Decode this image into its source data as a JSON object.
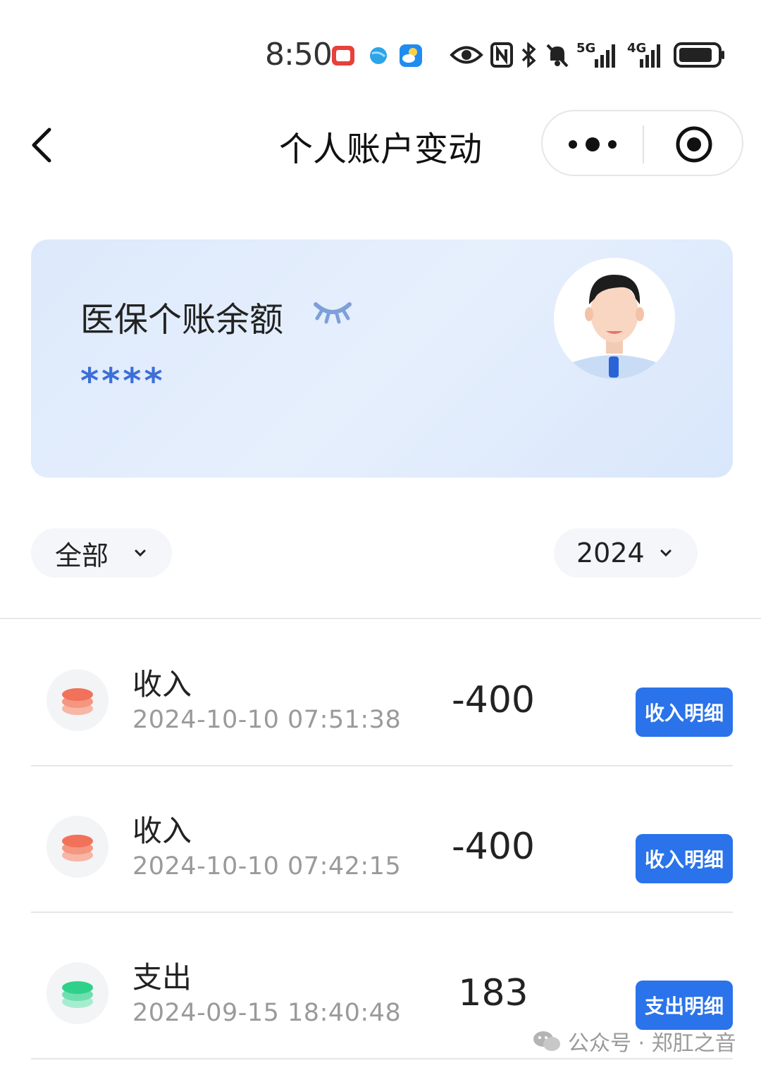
{
  "status_bar": {
    "time": "8:50",
    "signal_5g_label": "5G",
    "signal_4g_label": "4G",
    "icons": [
      "video-app-icon",
      "browser-app-icon",
      "weather-app-icon",
      "eye-icon",
      "nfc-icon",
      "bluetooth-icon",
      "mute-icon",
      "signal-5g-icon",
      "signal-4g-icon",
      "battery-icon"
    ]
  },
  "nav": {
    "title": "个人账户变动"
  },
  "card": {
    "title": "医保个账余额",
    "balance_masked": "****"
  },
  "filters": {
    "type_value": "全部",
    "year_value": "2024"
  },
  "transactions": [
    {
      "type": "收入",
      "time": "2024-10-10 07:51:38",
      "amount": "-400",
      "button": "收入明细",
      "kind": "income",
      "color": "#f2715a"
    },
    {
      "type": "收入",
      "time": "2024-10-10 07:42:15",
      "amount": "-400",
      "button": "收入明细",
      "kind": "income",
      "color": "#f2715a"
    },
    {
      "type": "支出",
      "time": "2024-09-15 18:40:48",
      "amount": "183",
      "button": "支出明细",
      "kind": "expense",
      "color": "#2fd18a"
    }
  ],
  "watermark": {
    "text": "公众号 · 郑肛之音"
  },
  "colors": {
    "accent": "#2a73ea",
    "balance": "#3d6fd8",
    "card_bg": "#dde9fb"
  }
}
